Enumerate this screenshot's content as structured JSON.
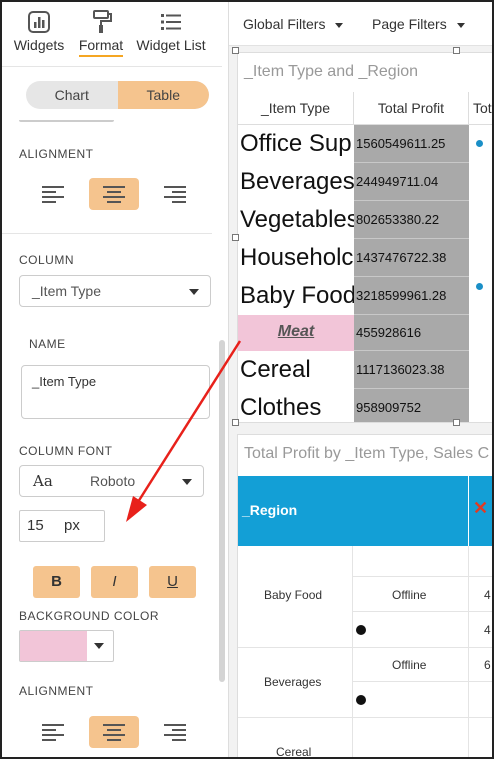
{
  "top_tabs": [
    {
      "label": "Widgets",
      "icon": "widgets-icon"
    },
    {
      "label": "Format",
      "icon": "format-paint-icon",
      "active": true
    },
    {
      "label": "Widget List",
      "icon": "list-icon"
    }
  ],
  "toggle": {
    "chart": "Chart",
    "table": "Table",
    "selected": "Table"
  },
  "sections": {
    "alignment": "ALIGNMENT",
    "column": "COLUMN",
    "name": "NAME",
    "column_font": "COLUMN FONT",
    "background_color": "BACKGROUND COLOR",
    "alignment2": "ALIGNMENT"
  },
  "column_select": "_Item Type",
  "name_value": "_Item Type",
  "font": {
    "sample": "Aa",
    "family": "Roboto"
  },
  "font_size": {
    "value": "15",
    "unit": "px"
  },
  "style_buttons": {
    "bold": "B",
    "italic": "I",
    "underline": "U"
  },
  "background_color": "#f2c5d8",
  "accent_color": "#f5c48e",
  "toolbar": {
    "global_filters": "Global Filters",
    "page_filters": "Page Filters"
  },
  "widget1": {
    "title": "_Item Type and _Region",
    "headers": [
      "_Item Type",
      "Total Profit",
      "Tota"
    ],
    "rows": [
      {
        "name": "Office Sup",
        "value": "1560549611.25"
      },
      {
        "name": "Beverages",
        "value": "244949711.04"
      },
      {
        "name": "Vegetables",
        "value": "802653380.22"
      },
      {
        "name": "Householc",
        "value": "1437476722.38"
      },
      {
        "name": "Baby Food",
        "value": "3218599961.28"
      },
      {
        "name": "Meat",
        "value": "455928616"
      },
      {
        "name": "Cereal",
        "value": "1117136023.38"
      },
      {
        "name": "Clothes",
        "value": "958909752"
      }
    ]
  },
  "widget2": {
    "title": "Total Profit by _Item Type, Sales C",
    "header": "_Region",
    "header_color": "#139fd6",
    "rows": [
      {
        "item": "Baby Food",
        "channel": "Offline",
        "v1": "4",
        "v2": "4"
      },
      {
        "item": "Beverages",
        "channel": "Offline",
        "v1": "6"
      },
      {
        "item": "Cereal"
      }
    ]
  }
}
